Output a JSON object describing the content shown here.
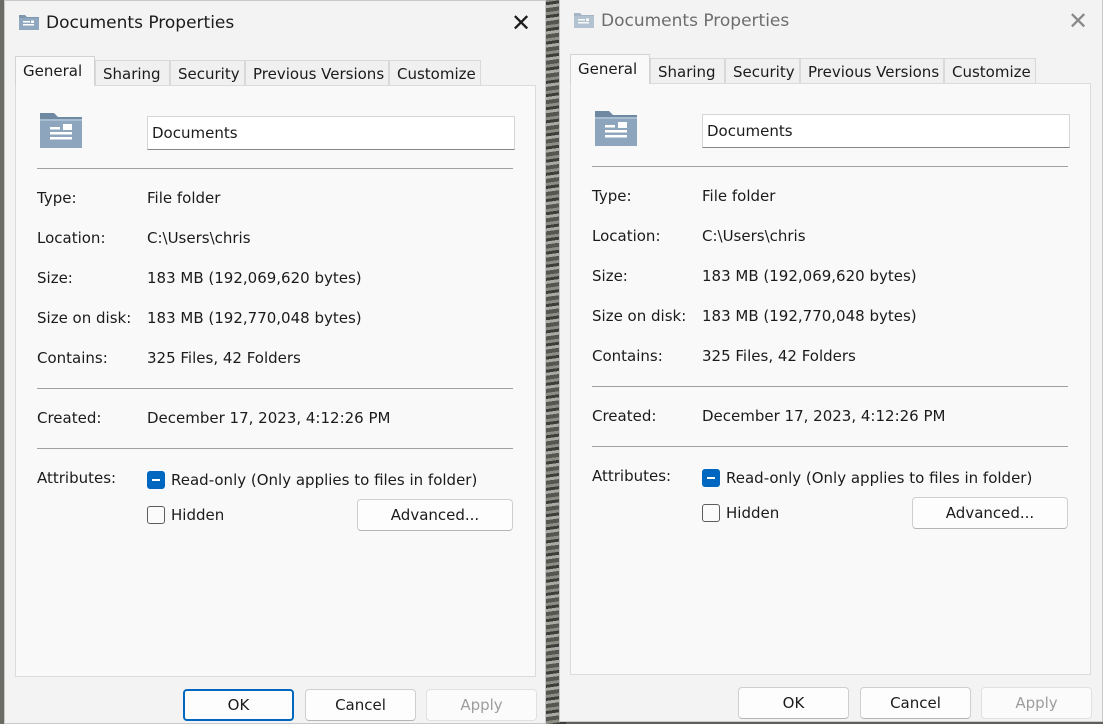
{
  "windows": [
    {
      "title": "Documents Properties",
      "close_glyph": "✕",
      "tabs": [
        "General",
        "Sharing",
        "Security",
        "Previous Versions",
        "Customize"
      ],
      "folder_name": "Documents",
      "properties": {
        "type_label": "Type:",
        "type_value": "File folder",
        "location_label": "Location:",
        "location_value": "C:\\Users\\chris",
        "size_label": "Size:",
        "size_value": "183 MB (192,069,620 bytes)",
        "size_on_disk_label": "Size on disk:",
        "size_on_disk_value": "183 MB (192,770,048 bytes)",
        "contains_label": "Contains:",
        "contains_value": "325 Files, 42 Folders",
        "created_label": "Created:",
        "created_value": "December 17, 2023, 4:12:26 PM"
      },
      "attributes": {
        "label": "Attributes:",
        "readonly_label": "Read-only (Only applies to files in folder)",
        "readonly_state": "indeterminate",
        "hidden_label": "Hidden",
        "hidden_state": "unchecked",
        "advanced_label": "Advanced..."
      },
      "buttons": {
        "ok": "OK",
        "cancel": "Cancel",
        "apply": "Apply"
      }
    },
    {
      "title": "Documents Properties",
      "close_glyph": "✕",
      "tabs": [
        "General",
        "Sharing",
        "Security",
        "Previous Versions",
        "Customize"
      ],
      "folder_name": "Documents",
      "properties": {
        "type_label": "Type:",
        "type_value": "File folder",
        "location_label": "Location:",
        "location_value": "C:\\Users\\chris",
        "size_label": "Size:",
        "size_value": "183 MB (192,069,620 bytes)",
        "size_on_disk_label": "Size on disk:",
        "size_on_disk_value": "183 MB (192,770,048 bytes)",
        "contains_label": "Contains:",
        "contains_value": "325 Files, 42 Folders",
        "created_label": "Created:",
        "created_value": "December 17, 2023, 4:12:26 PM"
      },
      "attributes": {
        "label": "Attributes:",
        "readonly_label": "Read-only (Only applies to files in folder)",
        "readonly_state": "indeterminate",
        "hidden_label": "Hidden",
        "hidden_state": "unchecked",
        "advanced_label": "Advanced..."
      },
      "buttons": {
        "ok": "OK",
        "cancel": "Cancel",
        "apply": "Apply"
      }
    }
  ],
  "colors": {
    "accent": "#0067c0",
    "dialog_bg": "#f3f3f3",
    "panel_bg": "#f9f9f9"
  },
  "icons": {
    "title_icon": "folder-documents-icon",
    "folder_icon": "folder-documents-icon",
    "close": "close-icon"
  }
}
